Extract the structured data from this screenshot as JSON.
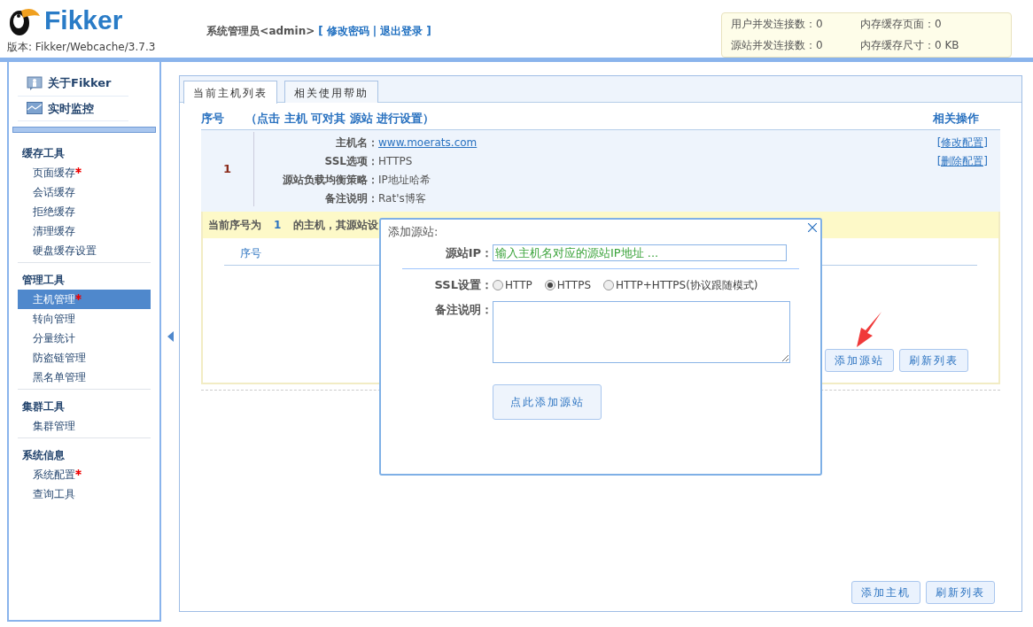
{
  "header": {
    "logo_text": "Fikker",
    "version": "版本: Fikker/Webcache/3.7.3",
    "user": "系统管理员<admin>",
    "bracket_open": "[",
    "links": [
      "修改密码",
      "退出登录"
    ],
    "separator": "|",
    "bracket_close": "]"
  },
  "stats": [
    "用户并发连接数：0",
    "内存缓存页面：0",
    "源站并发连接数：0",
    "内存缓存尺寸：0 KB"
  ],
  "sidebar": {
    "top_items": [
      {
        "label": "关于Fikker",
        "kind": "about"
      },
      {
        "label": "实时监控",
        "kind": "monitor"
      }
    ],
    "groups": [
      {
        "title": "缓存工具",
        "items": [
          {
            "label": "页面缓存",
            "starred": true,
            "selected": false
          },
          {
            "label": "会话缓存",
            "starred": false,
            "selected": false
          },
          {
            "label": "拒绝缓存",
            "starred": false,
            "selected": false
          },
          {
            "label": "清理缓存",
            "starred": false,
            "selected": false
          },
          {
            "label": "硬盘缓存设置",
            "starred": false,
            "selected": false
          }
        ]
      },
      {
        "title": "管理工具",
        "items": [
          {
            "label": "主机管理",
            "starred": true,
            "selected": true
          },
          {
            "label": "转向管理",
            "starred": false,
            "selected": false
          },
          {
            "label": "分量统计",
            "starred": false,
            "selected": false
          },
          {
            "label": "防盗链管理",
            "starred": false,
            "selected": false
          },
          {
            "label": "黑名单管理",
            "starred": false,
            "selected": false
          }
        ]
      },
      {
        "title": "集群工具",
        "items": [
          {
            "label": "集群管理",
            "starred": false,
            "selected": false
          }
        ]
      },
      {
        "title": "系统信息",
        "items": [
          {
            "label": "系统配置",
            "starred": true,
            "selected": false
          },
          {
            "label": "查询工具",
            "starred": false,
            "selected": false
          }
        ]
      }
    ]
  },
  "tabs": [
    {
      "label": "当前主机列表",
      "selected": true
    },
    {
      "label": "相关使用帮助",
      "selected": false
    }
  ],
  "host_table": {
    "columns": [
      "序号",
      "（点击 主机 可对其 源站 进行设置）",
      "相关操作"
    ],
    "rows": [
      {
        "index": "1",
        "fields": [
          {
            "label": "主机名：",
            "value": "www.moerats.com",
            "kind": "link"
          },
          {
            "label": "SSL选项：",
            "value": "HTTPS",
            "kind": "text"
          },
          {
            "label": "源站负载均衡策略：",
            "value": "IP地址哈希",
            "kind": "text"
          },
          {
            "label": "备注说明：",
            "value": "Rat's博客",
            "kind": "text"
          }
        ],
        "actions": [
          "[修改配置]",
          "[删除配置]"
        ]
      }
    ]
  },
  "source_panel": {
    "notice": [
      "当前序号为",
      "1",
      "的主机，其源站设"
    ],
    "columns": [
      "序号"
    ],
    "buttons": [
      "添加源站",
      "刷新列表"
    ]
  },
  "footer_buttons": [
    "添加主机",
    "刷新列表"
  ],
  "dialog": {
    "title": "添加源站:",
    "ip_label": "源站IP：",
    "ip_placeholder": "输入主机名对应的源站IP地址 ...",
    "ssl_label": "SSL设置：",
    "ssl_options": [
      {
        "label": "HTTP",
        "selected": false
      },
      {
        "label": "HTTPS",
        "selected": true
      },
      {
        "label": "HTTP+HTTPS(协议跟随模式)",
        "selected": false
      }
    ],
    "note_label": "备注说明：",
    "submit": "点此添加源站"
  }
}
